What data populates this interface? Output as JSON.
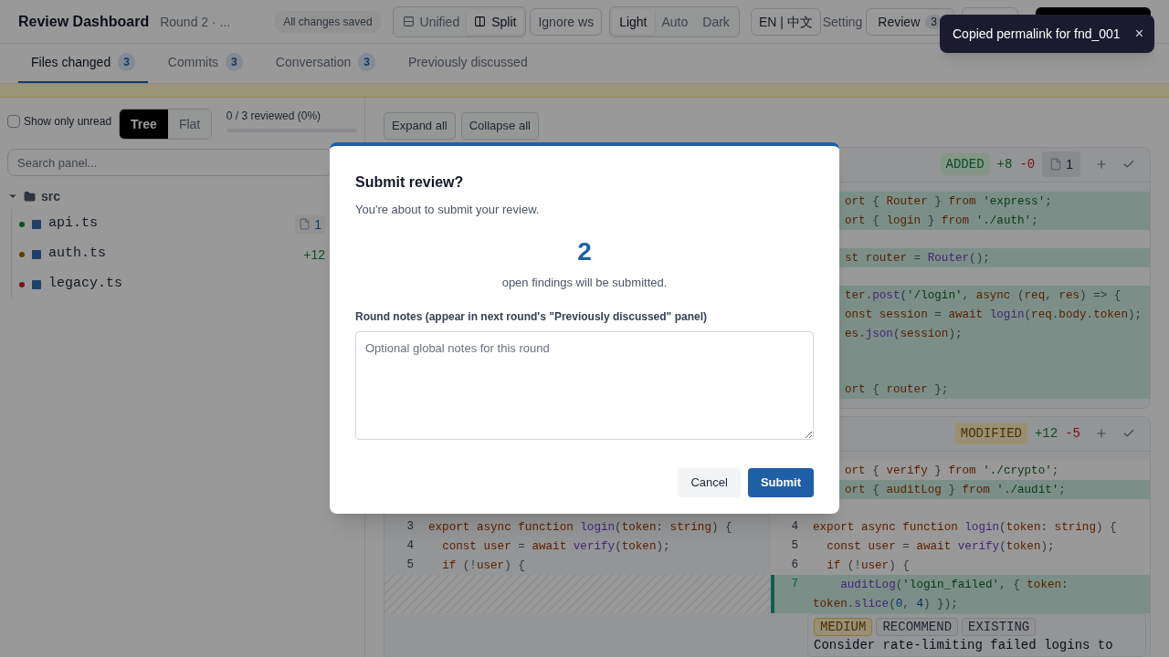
{
  "header": {
    "title": "Review Dashboard",
    "subtitle": "Round 2 · ...",
    "save_status": "All changes saved",
    "view_modes": [
      {
        "label": "Unified",
        "kind": "unified",
        "selected": false
      },
      {
        "label": "Split",
        "kind": "split",
        "selected": true
      }
    ],
    "ignore_ws": "Ignore ws",
    "themes": [
      {
        "label": "Light",
        "selected": true
      },
      {
        "label": "Auto",
        "selected": false
      },
      {
        "label": "Dark",
        "selected": false
      }
    ],
    "language": "EN | 中文",
    "settings": "Setting",
    "review_button": {
      "label": "Review",
      "count": "3"
    }
  },
  "tabs": [
    {
      "label": "Files changed",
      "count": "3",
      "selected": true
    },
    {
      "label": "Commits",
      "count": "3",
      "selected": false
    },
    {
      "label": "Conversation",
      "count": "3",
      "selected": false
    },
    {
      "label": "Previously discussed",
      "selected": false
    }
  ],
  "sidebar": {
    "unread_filter": {
      "label": "Show only unread",
      "checked": false
    },
    "layouts": [
      {
        "label": "Tree",
        "selected": true
      },
      {
        "label": "Flat",
        "selected": false
      }
    ],
    "progress": {
      "text": "0 / 3 reviewed (0%)",
      "level": 0
    },
    "search": {
      "placeholder": "Search panel..."
    },
    "tree": [
      {
        "name": "src",
        "expanded": true,
        "children": [
          {
            "name": "api.ts",
            "color": "#104c21",
            "findings": "1"
          },
          {
            "name": "auth.ts",
            "color": "#5c3e00",
            "additions": "+12"
          },
          {
            "name": "legacy.ts",
            "color": "#7c141c"
          }
        ]
      }
    ]
  },
  "diff": {
    "expand_all": "Expand all",
    "collapse_all": "Collapse all",
    "files": [
      {
        "status": "ADDED",
        "kind": "added",
        "additions": "+8",
        "deletions": "-0",
        "findings": "1",
        "rows": [
          {
            "right": {
              "code": "ort { Router } from 'express';",
              "added": true
            }
          },
          {
            "right": {
              "code": "ort { login } from './auth';",
              "added": true
            }
          },
          {
            "right": {
              "added": false
            }
          },
          {
            "right": {
              "code": "st router = Router();",
              "added": true
            }
          },
          {
            "right": {
              "added": false
            }
          },
          {
            "right": {
              "code": "ter.post('/login', async (req, res) => {",
              "added": true
            }
          },
          {
            "right": {
              "code": "onst session = await login(req.body.token);",
              "added": true
            }
          },
          {
            "right": {
              "code": "es.json(session);",
              "added": true
            }
          },
          {
            "right": {
              "added": true
            }
          },
          {
            "right": {
              "added": true
            }
          },
          {
            "right": {
              "code": "ort { router };",
              "added": true
            }
          }
        ]
      },
      {
        "status": "MODIFIED",
        "kind": "modified",
        "additions": "+12",
        "deletions": "-5",
        "rows": [
          {
            "right": {
              "code": "ort { verify } from './crypto';",
              "added": false
            }
          },
          {
            "right": {
              "code": "ort { auditLog } from './audit';",
              "added": true
            }
          },
          {
            "right": {
              "added": false
            }
          },
          {
            "left": {
              "num": "3",
              "code": "export async function login(token: string) {"
            },
            "right": {
              "num": "4",
              "code": "export async function login(token: string) {",
              "added": false
            }
          },
          {
            "left": {
              "num": "4",
              "code": "  const user = await verify(token);"
            },
            "right": {
              "num": "5",
              "code": "  const user = await verify(token);",
              "added": false
            }
          },
          {
            "left": {
              "num": "5",
              "code": "  if (!user) {"
            },
            "right": {
              "num": "6",
              "code": "  if (!user) {",
              "added": false
            }
          },
          {
            "left": {
              "kind": "empty"
            },
            "right": {
              "num": "7",
              "code": "    auditLog('login_failed', { token: token.slice(0, 4) });",
              "added": true
            }
          }
        ],
        "finding": {
          "tags": [
            {
              "label": "MEDIUM",
              "kind": "severity"
            },
            {
              "label": "RECOMMEND",
              "kind": "plain"
            },
            {
              "label": "EXISTING",
              "kind": "plain"
            }
          ],
          "text": "Consider rate-limiting failed logins to"
        }
      }
    ]
  },
  "modal": {
    "title": "Submit review?",
    "subtitle": "You're about to submit your review.",
    "count": "2",
    "count_caption": "open findings will be submitted.",
    "notes_label": "Round notes (appear in next round's \"Previously discussed\" panel)",
    "notes_placeholder": "Optional global notes for this round",
    "cancel": "Cancel",
    "submit": "Submit"
  },
  "toast": {
    "text": "Copied permalink for fnd_001",
    "close": "×"
  }
}
